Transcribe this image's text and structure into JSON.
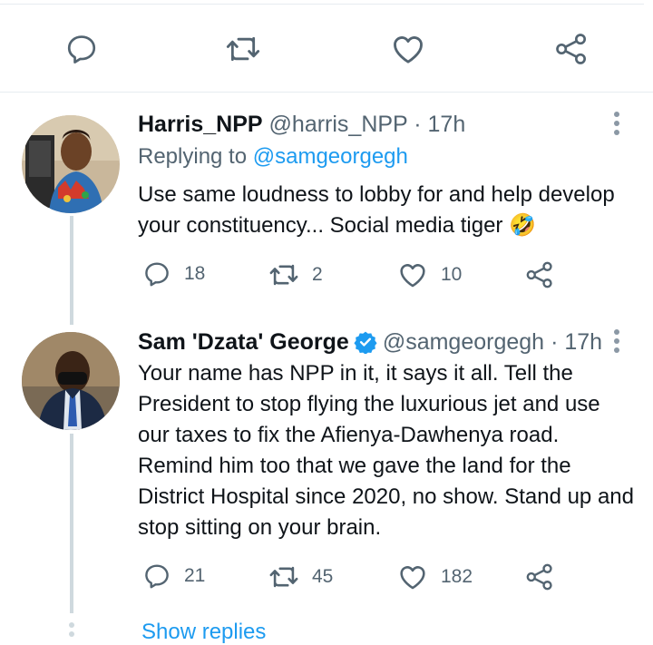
{
  "colors": {
    "accent": "#1d9bf0",
    "muted": "#536471",
    "divider": "#e6ecf0",
    "verified": "#1d9bf0"
  },
  "top_actions": [
    {
      "icon": "reply-icon"
    },
    {
      "icon": "retweet-icon"
    },
    {
      "icon": "like-icon"
    },
    {
      "icon": "share-icon"
    }
  ],
  "tweets": [
    {
      "display_name": "Harris_NPP",
      "handle": "@harris_NPP",
      "time": "· 17h",
      "replying_label": "Replying to",
      "replying_handle": "@samgeorgegh",
      "text": "Use same loudness to lobby for and help develop your constituency... Social media tiger 🤣",
      "replies": "18",
      "retweets": "2",
      "likes": "10",
      "verified": false
    },
    {
      "display_name": "Sam 'Dzata' George",
      "handle": "@samgeorgegh",
      "time": "· 17h",
      "text": "Your name has NPP in it, it says it all. Tell the President to stop flying the luxurious jet and use our taxes to fix the Afienya-Dawhenya road. Remind him too that we gave the land for the District Hospital since 2020, no show. Stand up and stop sitting on your brain.",
      "replies": "21",
      "retweets": "45",
      "likes": "182",
      "verified": true
    }
  ],
  "show_replies_label": "Show replies"
}
